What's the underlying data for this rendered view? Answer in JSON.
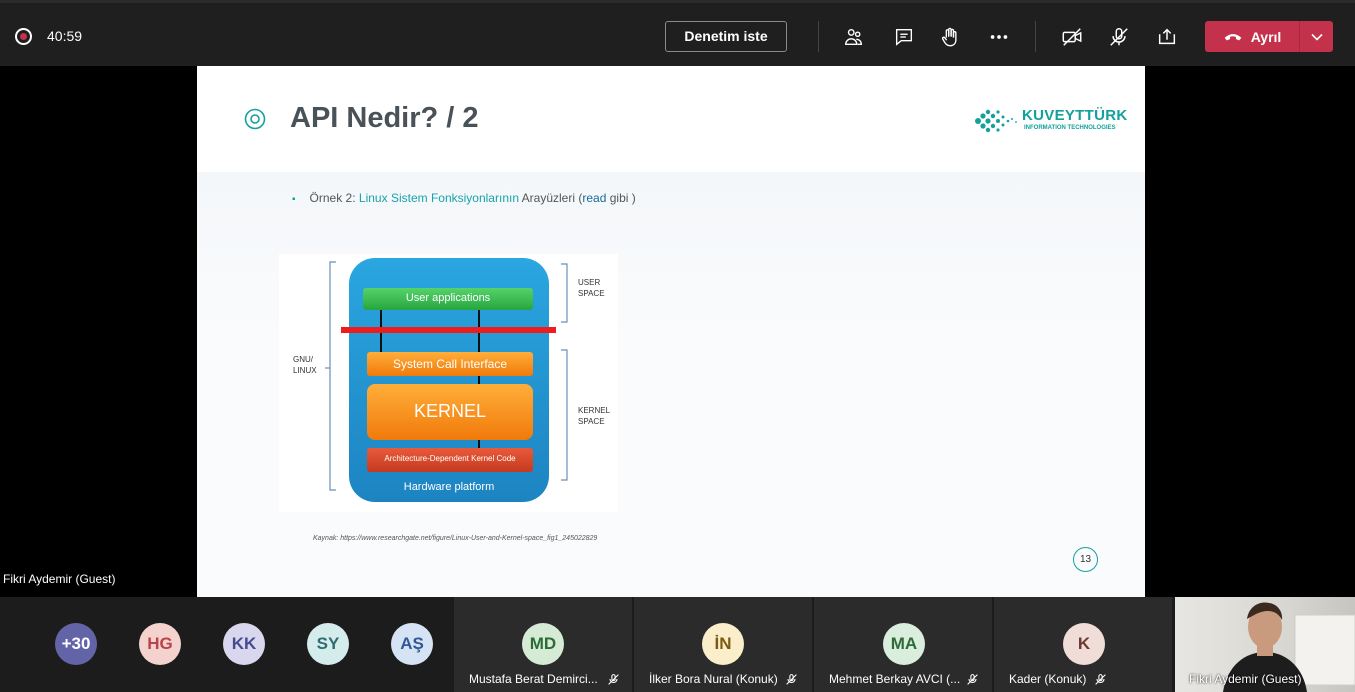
{
  "topbar": {
    "timer": "40:59",
    "admit_label": "Denetim iste",
    "leave_label": "Ayrıl",
    "icons": [
      "participants-icon",
      "chat-icon",
      "raise-hand-icon",
      "more-icon",
      "camera-off-icon",
      "mic-off-icon",
      "share-screen-icon"
    ],
    "leave_color": "#c4314b"
  },
  "stage": {
    "presenter_name": "Fikri Aydemir (Guest)"
  },
  "slide": {
    "title": "API Nedir? / 2",
    "logo_main": "KUVEYTTÜRK",
    "logo_sub": "INFORMATION TECHNOLOGIES",
    "bullet_prefix": "Örnek 2:",
    "bullet_link": "Linux Sistem Fonksiyonlarının",
    "bullet_mid": "Arayüzleri (",
    "bullet_read": "read",
    "bullet_end": "gibi )",
    "source": "Kaynak: https://www.researchgate.net/figure/Linux-User-and-Kernel-space_fig1_245022829",
    "page_number": "13",
    "accent_color": "#14a0a0",
    "diagram": {
      "left_label_1": "GNU/",
      "left_label_2": "LINUX",
      "user_space_1": "USER",
      "user_space_2": "SPACE",
      "kernel_space_1": "KERNEL",
      "kernel_space_2": "SPACE",
      "user_apps": "User applications",
      "syscall": "System Call Interface",
      "kernel": "KERNEL",
      "arch": "Architecture-Dependent Kernel Code",
      "hardware": "Hardware platform"
    }
  },
  "participants": {
    "overflow": "+30",
    "avatars": [
      {
        "initials": "HG",
        "bg": "#f4d3cf",
        "fg": "#b8434a"
      },
      {
        "initials": "KK",
        "bg": "#d8d7ee",
        "fg": "#474a8f"
      },
      {
        "initials": "SY",
        "bg": "#d5ecec",
        "fg": "#2e6c73"
      },
      {
        "initials": "AŞ",
        "bg": "#d6e3f4",
        "fg": "#2f5a93"
      }
    ],
    "tiles": [
      {
        "initials": "MD",
        "name": "Mustafa Berat Demirci...",
        "bg": "#d6ebd5",
        "fg": "#2e6b34"
      },
      {
        "initials": "İN",
        "name": "İlker Bora Nural (Konuk)",
        "bg": "#fbeecb",
        "fg": "#7d5a12"
      },
      {
        "initials": "MA",
        "name": "Mehmet Berkay AVCI (...",
        "bg": "#d9eedc",
        "fg": "#2f6b3a"
      },
      {
        "initials": "K",
        "name": "Kader (Konuk)",
        "bg": "#f1ddd8",
        "fg": "#6b3a30"
      }
    ],
    "overflow_bg": "#6264a7",
    "self_name": "Fikri Aydemir (Guest)"
  }
}
